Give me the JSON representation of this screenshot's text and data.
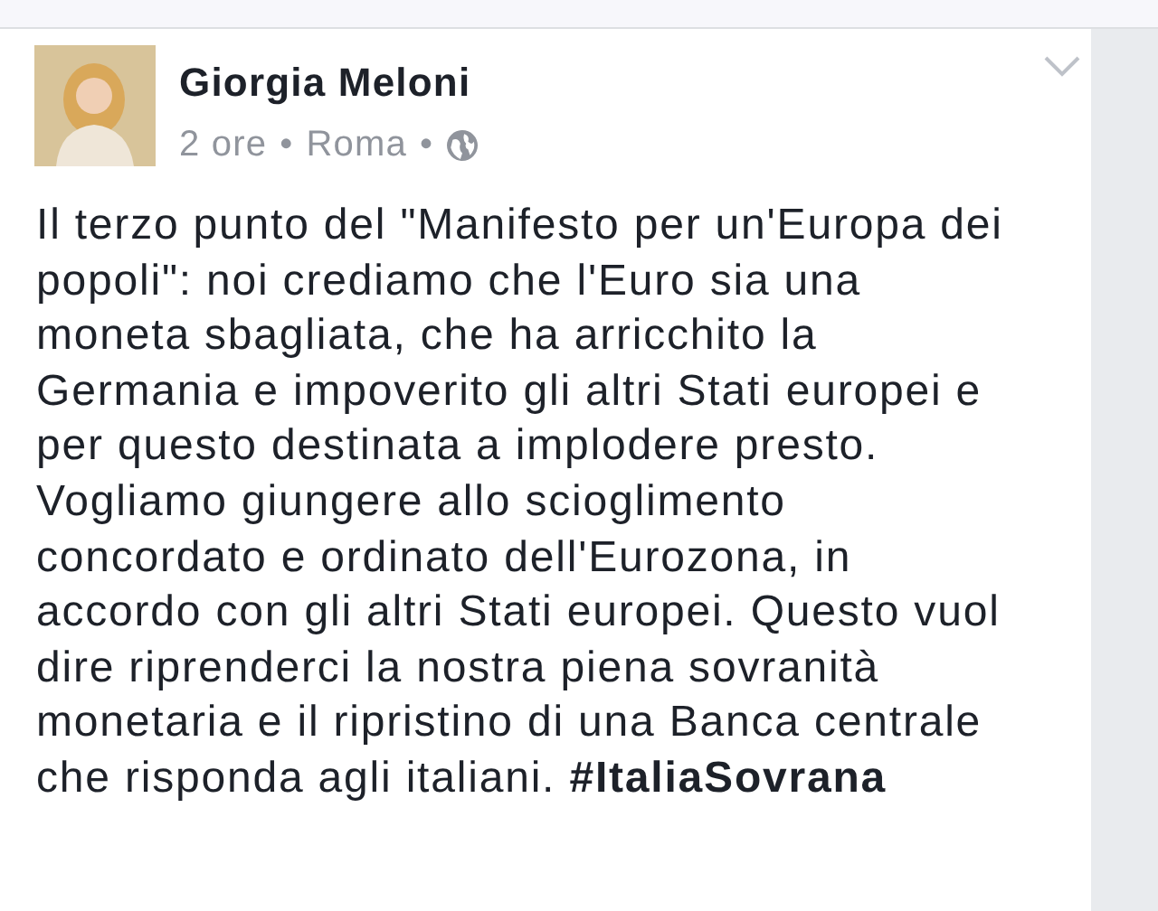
{
  "post": {
    "author": "Giorgia Meloni",
    "time": "2 ore",
    "separator_1": "•",
    "location": "Roma",
    "separator_2": "•",
    "body": "Il terzo punto del \"Manifesto per un'Europa dei\npopoli\": noi crediamo che l'Euro sia una\nmoneta sbagliata, che ha arricchito la\nGermania e impoverito gli altri Stati europei  e\nper questo destinata a implodere presto.\nVogliamo giungere allo scioglimento\nconcordato e ordinato dell'Eurozona, in\naccordo con gli altri Stati europei. Questo vuol\ndire riprenderci la nostra piena sovranità\nmonetaria e il ripristino di una Banca centrale\nche risponda agli italiani. **#ItaliaSovrana**"
  }
}
